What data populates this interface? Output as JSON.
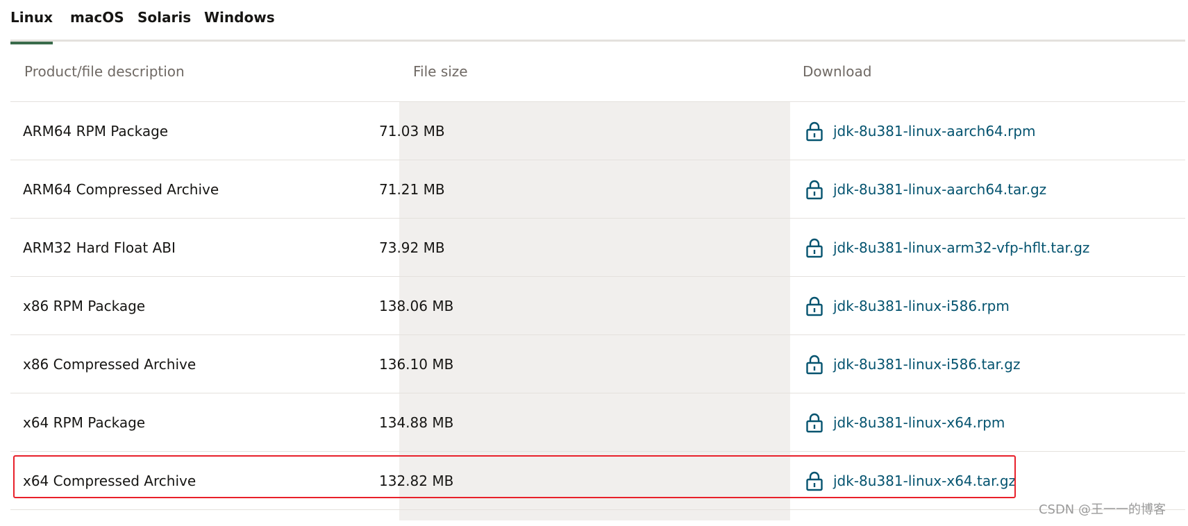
{
  "tabs": [
    {
      "label": "Linux",
      "active": true
    },
    {
      "label": "macOS",
      "active": false
    },
    {
      "label": "Solaris",
      "active": false
    },
    {
      "label": "Windows",
      "active": false
    }
  ],
  "table": {
    "headers": [
      "Product/file description",
      "File size",
      "Download"
    ],
    "rows": [
      {
        "description": "ARM64 RPM Package",
        "size": "71.03 MB",
        "file": "jdk-8u381-linux-aarch64.rpm"
      },
      {
        "description": "ARM64 Compressed Archive",
        "size": "71.21 MB",
        "file": "jdk-8u381-linux-aarch64.tar.gz"
      },
      {
        "description": "ARM32 Hard Float ABI",
        "size": "73.92 MB",
        "file": "jdk-8u381-linux-arm32-vfp-hflt.tar.gz"
      },
      {
        "description": "x86 RPM Package",
        "size": "138.06 MB",
        "file": "jdk-8u381-linux-i586.rpm"
      },
      {
        "description": "x86 Compressed Archive",
        "size": "136.10 MB",
        "file": "jdk-8u381-linux-i586.tar.gz"
      },
      {
        "description": "x64 RPM Package",
        "size": "134.88 MB",
        "file": "jdk-8u381-linux-x64.rpm"
      },
      {
        "description": "x64 Compressed Archive",
        "size": "132.82 MB",
        "file": "jdk-8u381-linux-x64.tar.gz"
      }
    ],
    "download_icon": "lock-icon"
  },
  "highlight_row": 7,
  "watermark": "CSDN @王一一的博客",
  "colors": {
    "tab_accent": "#3a6b4b",
    "link": "#04536f",
    "shaded_column": "#f1efed",
    "highlight_border": "#e8202a"
  }
}
